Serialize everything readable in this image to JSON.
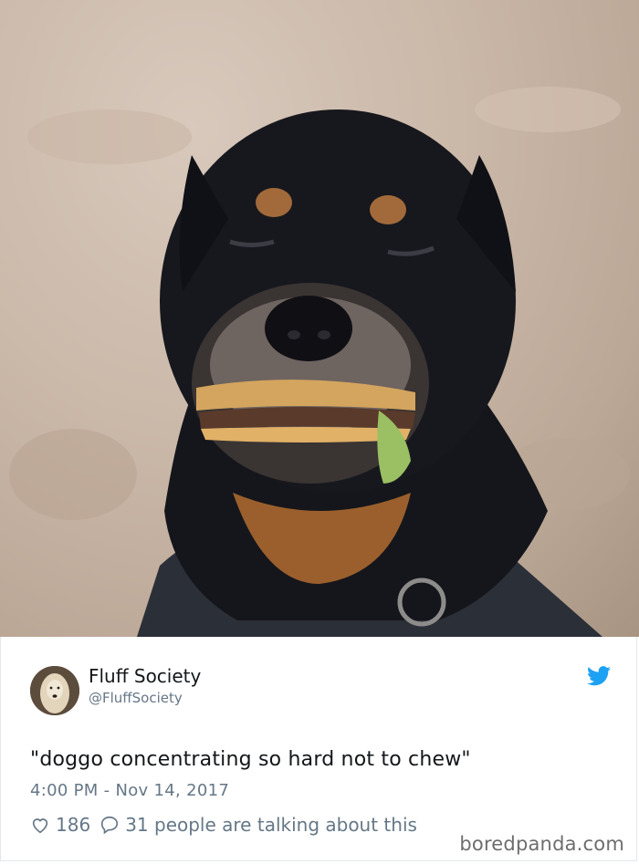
{
  "tweet": {
    "display_name": "Fluff Society",
    "handle": "@FluffSociety",
    "text": "\"doggo concentrating so hard not to chew\"",
    "timestamp": "4:00 PM - Nov 14, 2017",
    "likes": "186",
    "replies": "31 people are talking about this"
  },
  "icons": {
    "brand": "twitter-bird-icon",
    "like": "heart-icon",
    "reply": "comment-bubble-icon"
  },
  "colors": {
    "twitter_blue": "#1da1f2",
    "name_text": "#14171a",
    "meta_text": "#657786"
  },
  "watermark": "boredpanda.com"
}
